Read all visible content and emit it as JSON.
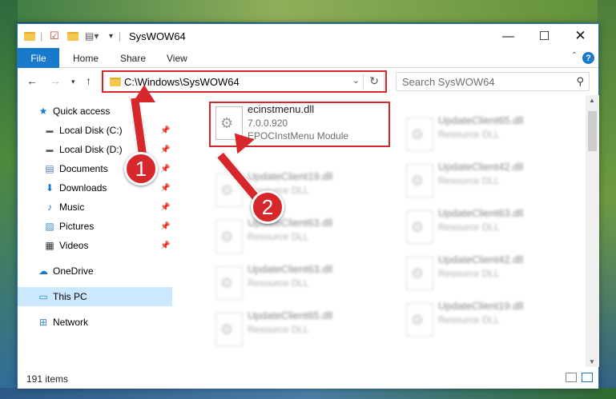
{
  "window": {
    "title": "SysWOW64"
  },
  "ribbon": {
    "file": "File",
    "home": "Home",
    "share": "Share",
    "view": "View",
    "help": "?"
  },
  "nav": {
    "address": "C:\\Windows\\SysWOW64",
    "search_placeholder": "Search SysWOW64"
  },
  "sidebar": {
    "items": [
      {
        "label": "Quick access",
        "icon": "star-icon"
      },
      {
        "label": "Local Disk (C:)",
        "icon": "drive-icon",
        "pinned": true
      },
      {
        "label": "Local Disk (D:)",
        "icon": "drive-icon",
        "pinned": true
      },
      {
        "label": "Documents",
        "icon": "documents-icon",
        "pinned": true
      },
      {
        "label": "Downloads",
        "icon": "download-icon",
        "pinned": true
      },
      {
        "label": "Music",
        "icon": "music-icon",
        "pinned": true
      },
      {
        "label": "Pictures",
        "icon": "pictures-icon",
        "pinned": true
      },
      {
        "label": "Videos",
        "icon": "videos-icon",
        "pinned": true
      },
      {
        "label": "OneDrive",
        "icon": "cloud-icon"
      },
      {
        "label": "This PC",
        "icon": "computer-icon",
        "selected": true
      },
      {
        "label": "Network",
        "icon": "network-icon"
      }
    ]
  },
  "files": {
    "highlighted": {
      "name": "ecinstmenu.dll",
      "version": "7.0.0.920",
      "description": "EPOCInstMenu Module"
    },
    "left_column": [
      {
        "name": "UpdateClient19.dll",
        "type": "Resource DLL"
      },
      {
        "name": "UpdateClient63.dll",
        "type": "Resource DLL"
      },
      {
        "name": "UpdateClient63.dll",
        "type": "Resource DLL"
      },
      {
        "name": "UpdateClient65.dll",
        "type": "Resource DLL"
      }
    ],
    "right_column": [
      {
        "name": "UpdateClient65.dll",
        "type": "Resource DLL"
      },
      {
        "name": "UpdateClient42.dll",
        "type": "Resource DLL"
      },
      {
        "name": "UpdateClient63.dll",
        "type": "Resource DLL"
      },
      {
        "name": "UpdateClient42.dll",
        "type": "Resource DLL"
      },
      {
        "name": "UpdateClient19.dll",
        "type": "Resource DLL"
      }
    ]
  },
  "status": {
    "count": "191 items"
  },
  "annotations": {
    "step1": "1",
    "step2": "2",
    "accent": "#d6282c"
  }
}
